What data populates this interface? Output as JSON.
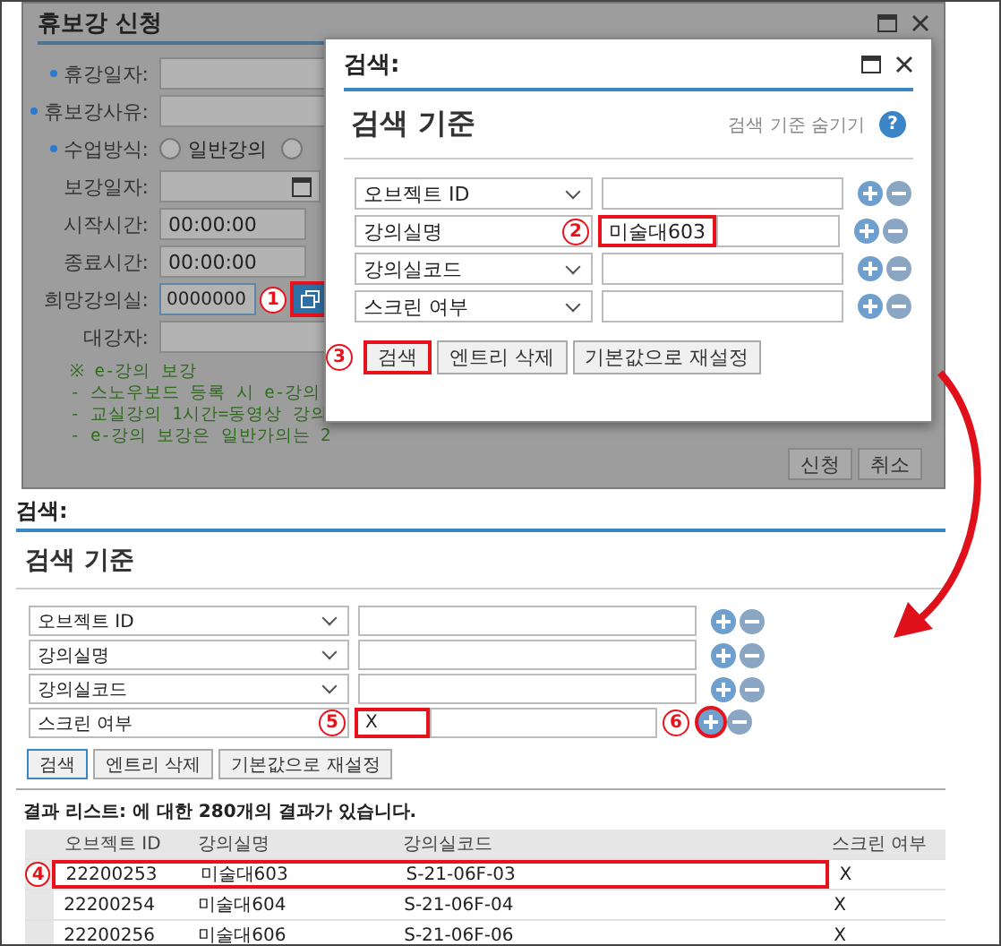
{
  "form_window": {
    "title": "휴보강 신청",
    "fields": [
      {
        "kind": "text",
        "label": "휴강일자:",
        "required": true
      },
      {
        "kind": "text",
        "label": "휴보강사유:",
        "required": true
      },
      {
        "kind": "radio",
        "label": "수업방식:",
        "required": true,
        "options": [
          {
            "label": "일반강의",
            "selected": false
          },
          {
            "selected": false
          }
        ]
      },
      {
        "kind": "date",
        "label": "보강일자:",
        "required": false
      },
      {
        "kind": "text",
        "label": "시작시간:",
        "required": false,
        "value": "00:00:00"
      },
      {
        "kind": "text",
        "label": "종료시간:",
        "required": false,
        "value": "00:00:00"
      },
      {
        "kind": "picker",
        "label": "희망강의실:",
        "required": false,
        "value": "0000000",
        "button_highlighted": true,
        "callout": "1"
      },
      {
        "kind": "text",
        "label": "대강자:",
        "required": false
      }
    ],
    "notes": [
      "※ e-강의 보강",
      "- 스노우보드 등록 시 e-강의",
      "- 교실강의 1시간=동영상 강의",
      "- e-강의 보강은 일반가의는 2"
    ],
    "buttons": [
      {
        "label": "신청"
      },
      {
        "label": "취소"
      }
    ]
  },
  "search_dialog": {
    "title": "검색:",
    "heading": "검색 기준",
    "hide_link": "검색 기준 숨기기",
    "help_icon": "?",
    "rows": [
      {
        "field": "오브젝트 ID",
        "highlighted": false
      },
      {
        "field": "강의실명",
        "value": "미술대603",
        "highlighted": true,
        "callout": "2"
      },
      {
        "field": "강의실코드",
        "highlighted": false
      },
      {
        "field": "스크린 여부",
        "highlighted": false
      }
    ],
    "buttons": [
      {
        "label": "검색",
        "highlighted": true,
        "callout": "3"
      },
      {
        "label": "엔트리 삭제",
        "highlighted": false
      },
      {
        "label": "기본값으로 재설정",
        "highlighted": false
      }
    ]
  },
  "search_panel": {
    "title": "검색:",
    "heading": "검색 기준",
    "rows": [
      {
        "field": "오브젝트 ID",
        "highlighted": false
      },
      {
        "field": "강의실명",
        "highlighted": false
      },
      {
        "field": "강의실코드",
        "highlighted": false
      },
      {
        "field": "스크린 여부",
        "value": "X",
        "highlighted": true,
        "callout": "5",
        "add_highlighted": true,
        "add_callout": "6"
      }
    ],
    "buttons": [
      {
        "label": "검색",
        "highlighted": false
      },
      {
        "label": "엔트리 삭제",
        "highlighted": false
      },
      {
        "label": "기본값으로 재설정",
        "highlighted": false
      }
    ],
    "result_summary": "결과 리스트: 에 대한 280개의 결과가 있습니다.",
    "table": {
      "columns": [
        "오브젝트 ID",
        "강의실명",
        "강의실코드",
        "스크린 여부"
      ],
      "rows": [
        {
          "cells": [
            "22200253",
            "미술대603",
            "S-21-06F-03",
            "X"
          ],
          "highlighted": true,
          "callout": "4"
        },
        {
          "cells": [
            "22200254",
            "미술대604",
            "S-21-06F-04",
            "X"
          ],
          "highlighted": false
        },
        {
          "cells": [
            "22200256",
            "미술대606",
            "S-21-06F-06",
            "X"
          ],
          "highlighted": false
        }
      ]
    }
  }
}
